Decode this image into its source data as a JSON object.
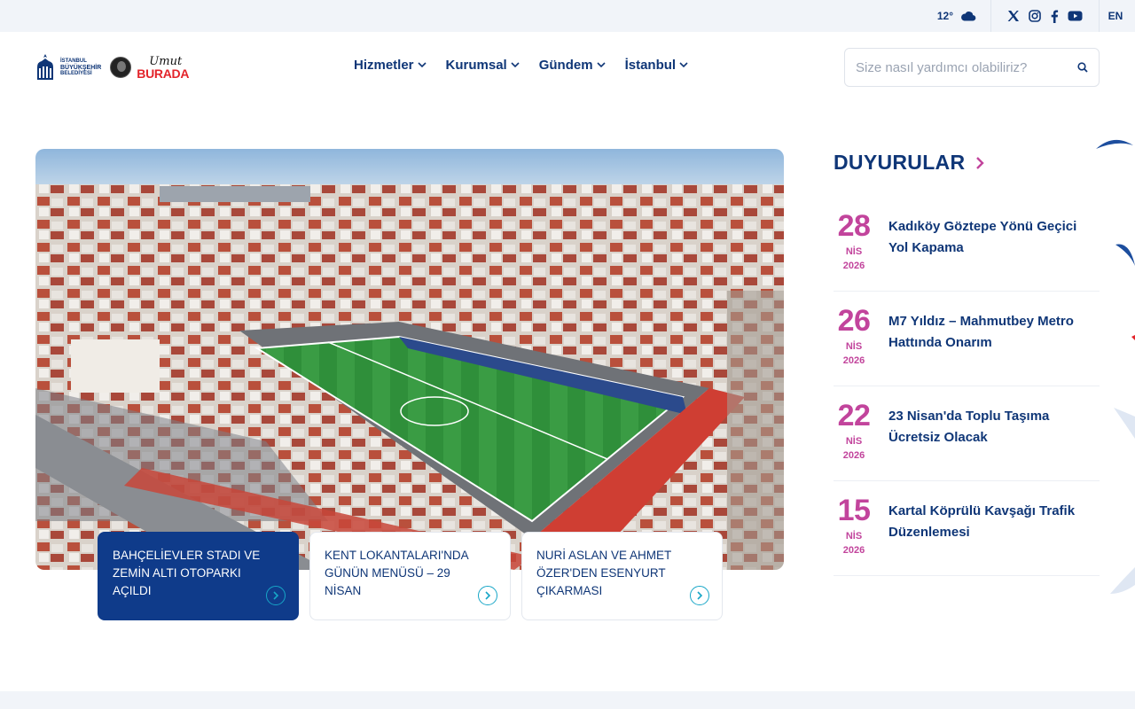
{
  "topbar": {
    "temperature": "12°",
    "weather_icon": "cloud-icon",
    "socials": [
      "x-icon",
      "instagram-icon",
      "facebook-icon",
      "youtube-icon"
    ],
    "language": "EN"
  },
  "header": {
    "logo_lines": [
      "İSTANBUL",
      "BÜYÜKŞEHİR",
      "BELEDİYESİ"
    ],
    "campaign_script": "Umut",
    "campaign_word": "BURADA",
    "nav": [
      {
        "label": "Hizmetler"
      },
      {
        "label": "Kurumsal"
      },
      {
        "label": "Gündem"
      },
      {
        "label": "İstanbul"
      }
    ],
    "search_placeholder": "Size nasıl yardımcı olabiliriz?"
  },
  "slider": {
    "cards": [
      {
        "title": "BAHÇELİEVLER STADI VE ZEMİN ALTI OTOPARKI AÇILDI",
        "active": true
      },
      {
        "title": "KENT LOKANTALARI'NDA GÜNÜN MENÜSÜ – 29 NİSAN",
        "active": false
      },
      {
        "title": "NURİ ASLAN VE AHMET ÖZER'DEN ESENYURT ÇIKARMASI",
        "active": false
      }
    ]
  },
  "announcements": {
    "title": "DUYURULAR",
    "items": [
      {
        "day": "28",
        "month": "NİS",
        "year": "2026",
        "title": "Kadıköy Göztepe Yönü Geçici Yol Kapama"
      },
      {
        "day": "26",
        "month": "NİS",
        "year": "2026",
        "title": "M7 Yıldız – Mahmutbey Metro Hattında Onarım"
      },
      {
        "day": "22",
        "month": "NİS",
        "year": "2026",
        "title": "23 Nisan'da Toplu Taşıma Ücretsiz Olacak"
      },
      {
        "day": "15",
        "month": "NİS",
        "year": "2026",
        "title": "Kartal Köprülü Kavşağı Trafik Düzenlemesi"
      }
    ]
  },
  "colors": {
    "primary": "#0f3677",
    "accent": "#c2449c",
    "active_card": "#0f3b8a",
    "arrow": "#17a6c7"
  }
}
